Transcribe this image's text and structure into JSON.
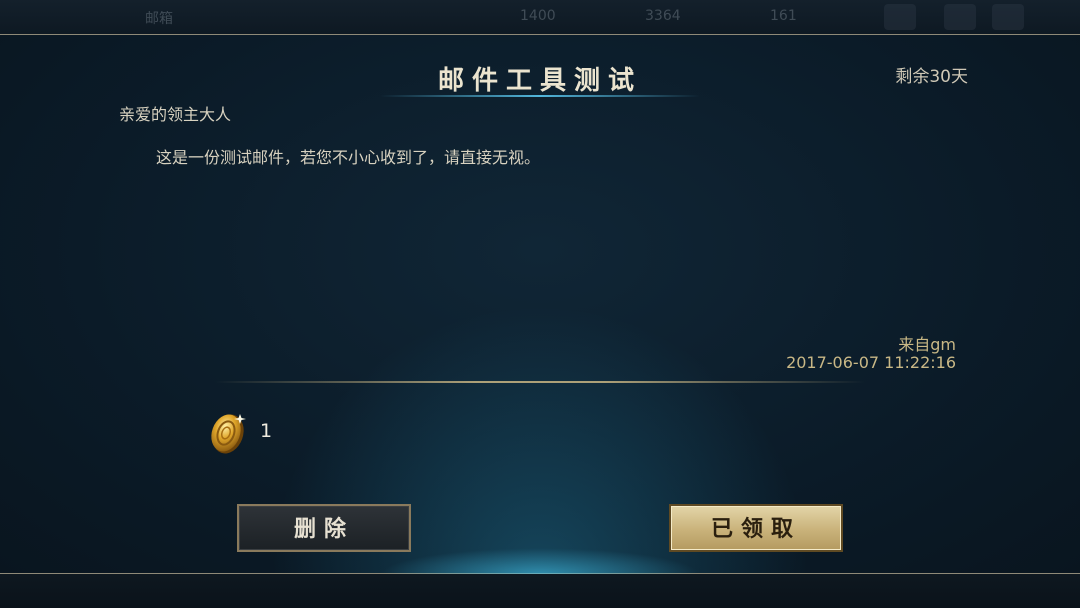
{
  "background_header": {
    "item_1": "邮箱",
    "item_2": "1400",
    "item_3": "3364",
    "item_4": "161"
  },
  "mail": {
    "title": "邮件工具测试",
    "remaining": "剩余30天",
    "greeting": "亲爱的领主大人",
    "body": "这是一份测试邮件，若您不小心收到了，请直接无视。",
    "sender": "来自gm",
    "sent_time": "2017-06-07 11:22:16"
  },
  "reward": {
    "icon": "gold-coin-icon",
    "count": "1"
  },
  "buttons": {
    "delete_label": "删除",
    "claimed_label": "已领取"
  },
  "colors": {
    "background": "#0c1a26",
    "title_glow": "#5ac8f0",
    "sender_text": "#c9b886",
    "claimed_button": "#c9b27a"
  }
}
